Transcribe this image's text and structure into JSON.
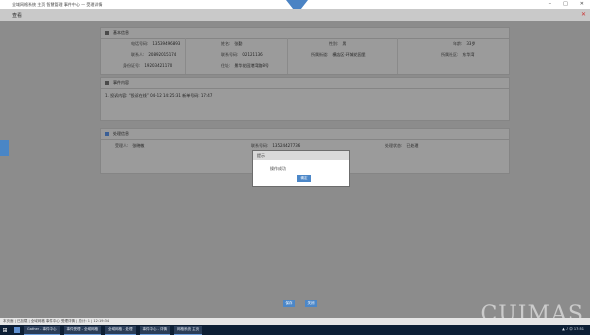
{
  "window": {
    "title": "全域网格系统 主页 智慧管理 事件中心 — 受理详情",
    "page_title": "查看",
    "min": "–",
    "max": "□",
    "close": "✕",
    "page_close": "✕"
  },
  "section_basic": {
    "title": "基本信息",
    "rows": [
      [
        {
          "label": "电话号码:",
          "value": "13539496893"
        },
        {
          "label": "姓名:",
          "value": "张勤"
        },
        {
          "label": "性别:",
          "value": "男"
        },
        {
          "label": "年龄:",
          "value": "33岁"
        }
      ],
      [
        {
          "label": "联系人:",
          "value": "20892015174"
        },
        {
          "label": "联系号码:",
          "value": "02121136"
        },
        {
          "label": "所属街道:",
          "value": "横店区·环城花园里"
        },
        {
          "label": "所属社区:",
          "value": "东华湾"
        }
      ],
      [
        {
          "label": "身份证号:",
          "value": "19203421170"
        },
        {
          "label": "住址:",
          "value": "景华花园港湾路8号"
        }
      ]
    ]
  },
  "section_event": {
    "title": "事件内容",
    "text": "1. 投诉内容: “投诉在线”  04-12 14:25:31 新单号码: 17:47"
  },
  "section_dispatch": {
    "title": "处理信息",
    "handler_label": "受理人:",
    "handler_value": "张晓敏",
    "phone_label": "联系号码:",
    "phone_value": "13524427736",
    "status_label": "处理状态:",
    "status_value": "已处理"
  },
  "dialog": {
    "title": "提示",
    "message": "操作成功",
    "ok": "确定"
  },
  "buttons": {
    "save": "保存",
    "close": "关闭"
  },
  "statusbar": "本页面 | 已加载 | 全域网格 事件中心 受理详情 | 总计: 1 | 12:19:34",
  "taskbar": {
    "items": [
      "Gather - 事件中心",
      "事件受理 - 全域网格",
      "全域网格 - 处理",
      "事件中心 - 详情",
      "网格系统 主页"
    ],
    "tray": "▲ ♪ 中 17:51"
  },
  "watermark": "CUIMAS"
}
